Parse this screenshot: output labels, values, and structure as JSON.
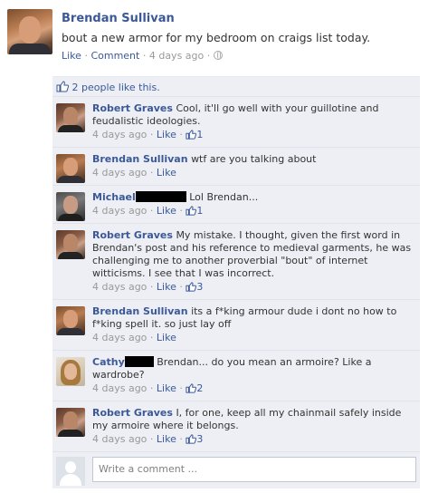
{
  "post": {
    "author": "Brendan Sullivan",
    "text": "bout a new armor for my bedroom on craigs list today.",
    "like_label": "Like",
    "comment_label": "Comment",
    "time": "4 days ago",
    "sep": "·"
  },
  "likes": {
    "text": "2 people like this."
  },
  "comments": [
    {
      "author": "Robert Graves",
      "text": "Cool, it'll go well with your guillotine and feudalistic ideologies.",
      "time": "4 days ago",
      "like_label": "Like",
      "like_count": "1",
      "avatar": "robert"
    },
    {
      "author": "Brendan Sullivan",
      "text": "wtf are you talking about",
      "time": "4 days ago",
      "like_label": "Like",
      "like_count": "",
      "avatar": "brendan"
    },
    {
      "author": "Michael",
      "text": "Lol Brendan...",
      "time": "4 days ago",
      "like_label": "Like",
      "like_count": "1",
      "avatar": "michael"
    },
    {
      "author": "Robert Graves",
      "text": "My mistake. I thought, given the first word in Brendan's post and his reference to medieval garments, he was challenging me to another proverbial \"bout\" of internet witticisms. I see that I was incorrect.",
      "time": "4 days ago",
      "like_label": "Like",
      "like_count": "3",
      "avatar": "robert"
    },
    {
      "author": "Brendan Sullivan",
      "text": "its a f*king armour dude i dont no how to f*king spell it. so just lay off",
      "time": "4 days ago",
      "like_label": "Like",
      "like_count": "",
      "avatar": "brendan"
    },
    {
      "author": "Cathy",
      "text": "Brendan... do you mean an armoire? Like a wardrobe?",
      "time": "4 days ago",
      "like_label": "Like",
      "like_count": "2",
      "avatar": "cathy"
    },
    {
      "author": "Robert Graves",
      "text": "I, for one, keep all my chainmail safely inside my armoire where it belongs.",
      "time": "4 days ago",
      "like_label": "Like",
      "like_count": "3",
      "avatar": "robert"
    }
  ],
  "write_comment": {
    "placeholder": "Write a comment ..."
  },
  "colors": {
    "link": "#3b5998",
    "panel": "#edeff4",
    "meta": "#999999"
  }
}
